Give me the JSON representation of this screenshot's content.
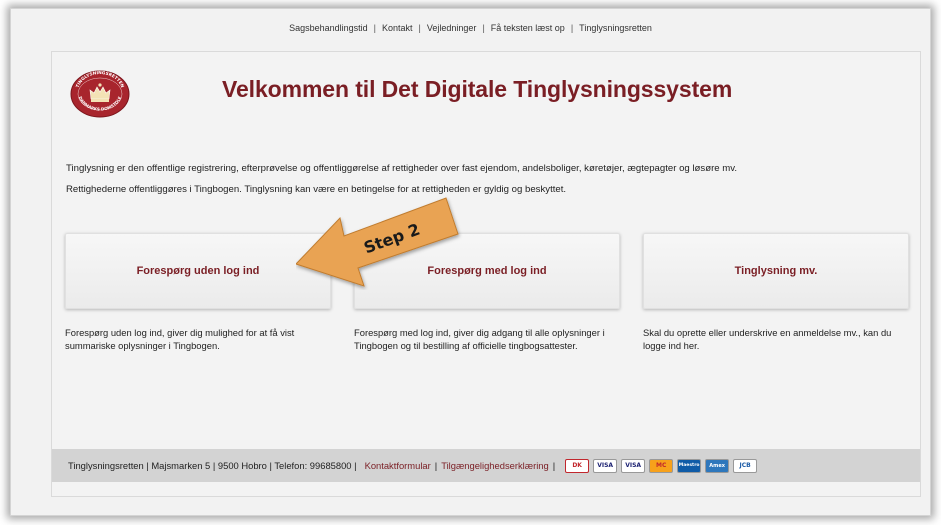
{
  "topnav": {
    "items": [
      "Sagsbehandlingstid",
      "Kontakt",
      "Vejledninger",
      "Få teksten læst op",
      "Tinglysningsretten"
    ]
  },
  "logo": {
    "top_text": "TINGLYSNINGSRETTEN",
    "bottom_text": "DANMARKS DOMSTOLE"
  },
  "header": {
    "title": "Velkommen til Det Digitale Tinglysningssystem"
  },
  "intro": {
    "line1": "Tinglysning er den offentlige registrering, efterprøvelse og offentliggørelse af rettigheder over fast ejendom, andelsboliger, køretøjer, ægtepagter og løsøre mv.",
    "line2": "Rettighederne offentliggøres i Tingbogen. Tinglysning kan være en betingelse for at rettigheden er gyldig og beskyttet."
  },
  "cards": [
    {
      "label": "Forespørg uden log ind",
      "desc": "Forespørg uden log ind, giver dig mulighed for at få vist summariske oplysninger i Tingbogen."
    },
    {
      "label": "Forespørg med log ind",
      "desc": "Forespørg med log ind, giver dig adgang til alle oplysninger i Tingbogen og til bestilling af officielle tingbogsattester."
    },
    {
      "label": "Tinglysning mv.",
      "desc": "Skal du oprette eller underskrive en anmeldelse mv., kan du logge ind her."
    }
  ],
  "annotation": {
    "label": "Step 2",
    "color": "#e9a353"
  },
  "footer": {
    "info": "Tinglysningsretten | Majsmarken 5 | 9500 Hobro | Telefon: 99685800 |",
    "contact_link": "Kontaktformular",
    "access_link": "Tilgængelighedserklæring",
    "payment_cards": [
      "DK",
      "VISA",
      "VISA",
      "MC",
      "Maestro",
      "Amex",
      "JCB"
    ]
  },
  "colors": {
    "brand": "#7a1e24",
    "footer_bg": "#d3d3d3"
  }
}
